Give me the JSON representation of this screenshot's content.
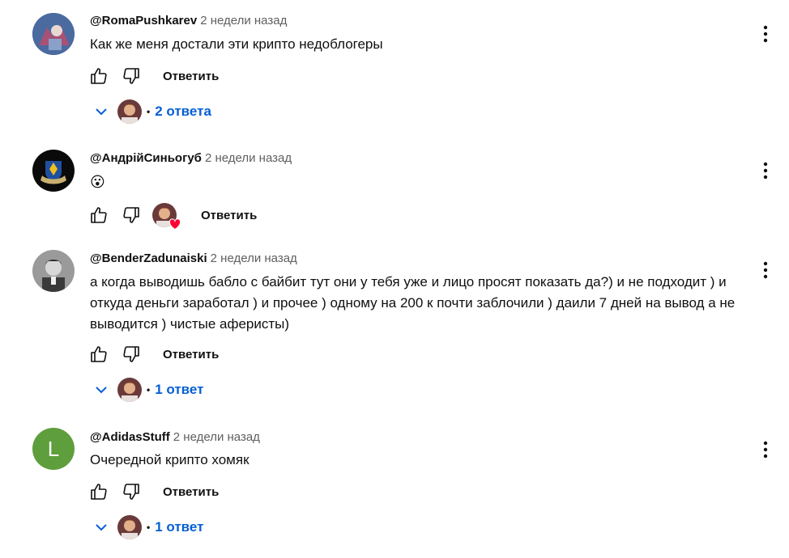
{
  "comments": [
    {
      "author": "@RomaPushkarev",
      "time": "2 недели назад",
      "text": "Как же меня достали эти крипто недоблогеры",
      "reply_label": "Ответить",
      "replies_label": "2 ответа"
    },
    {
      "author": "@АндрійСиньогуб",
      "time": "2 недели назад",
      "text": "😮",
      "reply_label": "Ответить"
    },
    {
      "author": "@BenderZadunaiski",
      "time": "2 недели назад",
      "text": "а когда выводишь бабло с байбит тут они у тебя уже и лицо просят показать да?) и не подходит ) и откуда деньги заработал ) и прочее ) одному на 200 к почти заблочили ) даили 7 дней на вывод а не выводится ) чистые аферисты)",
      "reply_label": "Ответить",
      "replies_label": "1 ответ"
    },
    {
      "author": "@AdidasStuff",
      "avatar_letter": "L",
      "time": "2 недели назад",
      "text": "Очередной крипто хомяк",
      "reply_label": "Ответить",
      "replies_label": "1 ответ"
    }
  ],
  "dot": "•",
  "icons": {
    "like": "thumb-up-icon",
    "dislike": "thumb-down-icon",
    "menu": "more-vert-icon",
    "expand": "chevron-down-icon",
    "heart": "heart-icon"
  },
  "colors": {
    "link_blue": "#065fd4",
    "heart_red": "#ff0033",
    "letter_avatar_bg": "#5e9e3c",
    "meta_gray": "#606060"
  }
}
